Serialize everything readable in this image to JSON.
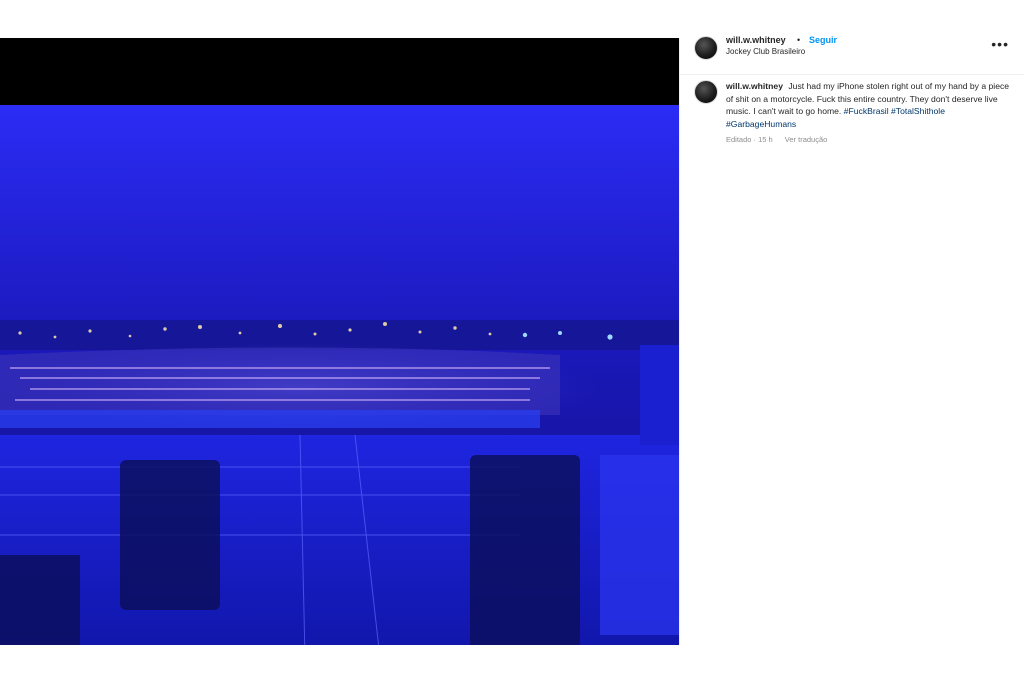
{
  "post": {
    "username": "will.w.whitney",
    "follow_label": "Seguir",
    "separator": "•",
    "location": "Jockey Club Brasileiro",
    "more_icon": "more-horizontal-icon",
    "caption_parts": [
      {
        "text": "Just had my iPhone stolen right out of my hand by a piece of shit on a motorcycle. Fuck this entire country. They don't deserve live music. I can't wait to go home. ",
        "type": "plain"
      },
      {
        "text": "#FuckBrasil",
        "type": "tag"
      },
      {
        "text": " ",
        "type": "plain"
      },
      {
        "text": "#TotalShithole",
        "type": "tag"
      },
      {
        "text": " ",
        "type": "plain"
      },
      {
        "text": "#GarbageHumans",
        "type": "tag"
      }
    ],
    "edited_label": "Editado · 15 h",
    "translate_label": "Ver tradução"
  },
  "colors": {
    "link_blue": "#0095f6",
    "hashtag": "#00376b",
    "stage_blue": "#1b1ad0"
  }
}
